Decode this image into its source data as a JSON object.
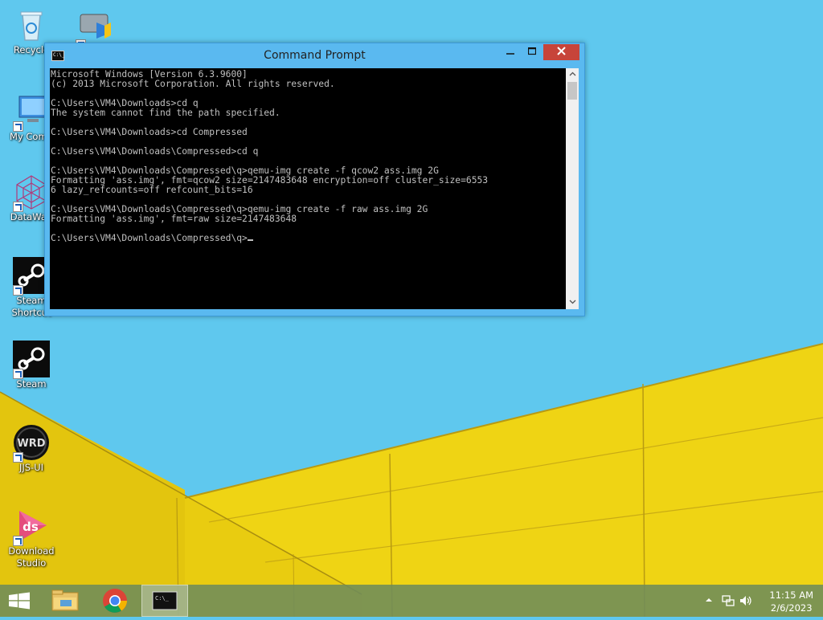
{
  "desktop": {
    "icons": [
      {
        "label": "Recycle"
      },
      {
        "label": "My Comp"
      },
      {
        "label": "DataWag"
      },
      {
        "label": "Steam\nShortcut"
      },
      {
        "label": "Steam"
      },
      {
        "label": "JJS-UI"
      },
      {
        "label": "Download\nStudio"
      }
    ]
  },
  "window": {
    "title": "Command Prompt",
    "console_lines": [
      "Microsoft Windows [Version 6.3.9600]",
      "(c) 2013 Microsoft Corporation. All rights reserved.",
      "",
      "C:\\Users\\VM4\\Downloads>cd q",
      "The system cannot find the path specified.",
      "",
      "C:\\Users\\VM4\\Downloads>cd Compressed",
      "",
      "C:\\Users\\VM4\\Downloads\\Compressed>cd q",
      "",
      "C:\\Users\\VM4\\Downloads\\Compressed\\q>qemu-img create -f qcow2 ass.img 2G",
      "Formatting 'ass.img', fmt=qcow2 size=2147483648 encryption=off cluster_size=6553",
      "6 lazy_refcounts=off refcount_bits=16",
      "",
      "C:\\Users\\VM4\\Downloads\\Compressed\\q>qemu-img create -f raw ass.img 2G",
      "Formatting 'ass.img', fmt=raw size=2147483648",
      "",
      "C:\\Users\\VM4\\Downloads\\Compressed\\q>"
    ],
    "icon_text": "C:\\_"
  },
  "taskbar": {
    "clock_time": "11:15 AM",
    "clock_date": "2/6/2023"
  },
  "colors": {
    "sky": "#5fc8ee",
    "wall_yellow": "#f0d512",
    "taskbar": "#6e8c5a",
    "window_frame": "#5ab9f0",
    "close_button": "#c7443a"
  }
}
